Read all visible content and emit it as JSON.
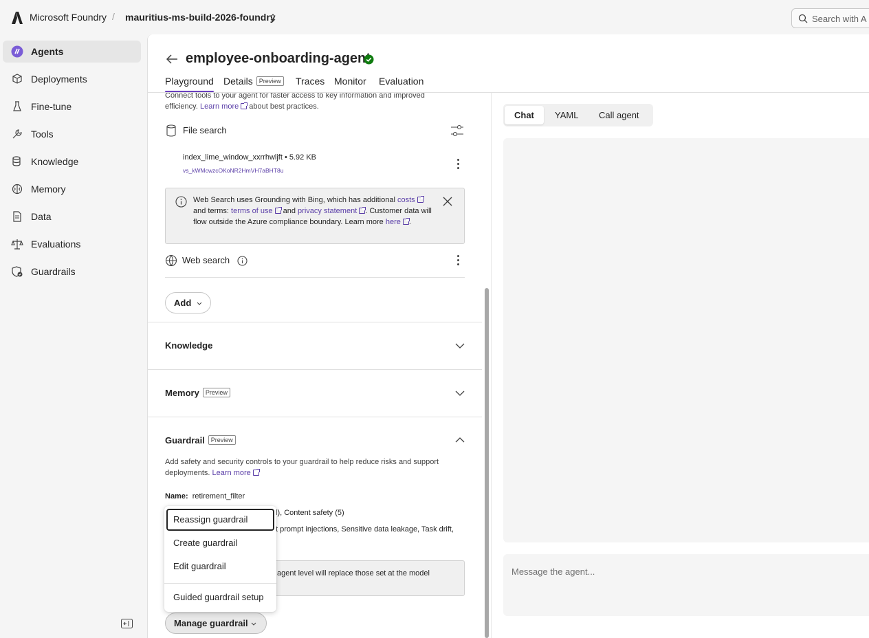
{
  "topbar": {
    "brand": "Microsoft Foundry",
    "separator": "/",
    "project": "mauritius-ms-build-2026-foundry",
    "search_placeholder": "Search with A"
  },
  "sidebar": {
    "items": [
      {
        "label": "Agents",
        "icon": "agents-icon",
        "active": true
      },
      {
        "label": "Deployments",
        "icon": "deployments-icon"
      },
      {
        "label": "Fine-tune",
        "icon": "flask-icon"
      },
      {
        "label": "Tools",
        "icon": "wrench-icon"
      },
      {
        "label": "Knowledge",
        "icon": "database-icon"
      },
      {
        "label": "Memory",
        "icon": "brain-icon"
      },
      {
        "label": "Data",
        "icon": "document-icon"
      },
      {
        "label": "Evaluations",
        "icon": "scale-icon"
      },
      {
        "label": "Guardrails",
        "icon": "shield-icon"
      }
    ]
  },
  "agent": {
    "title": "employee-onboarding-agent",
    "status_color": "#107c10"
  },
  "tabs": [
    {
      "label": "Playground",
      "active": true
    },
    {
      "label": "Details",
      "badge": "Preview"
    },
    {
      "label": "Traces"
    },
    {
      "label": "Monitor"
    },
    {
      "label": "Evaluation"
    }
  ],
  "tools": {
    "intro_text": "Connect tools to your agent for faster access to key information and improved efficiency.",
    "intro_link": "Learn more",
    "intro_suffix": "about best practices.",
    "file_search": {
      "title": "File search",
      "file_name": "index_lime_window_xxrrhwljft • 5.92 KB",
      "file_id": "vs_kWMcwzcOKoNR2HmVH7aBHT8u"
    },
    "notice": {
      "t1": "Web Search uses Grounding with Bing, which has additional",
      "l1": "costs",
      "t2": "and terms:",
      "l2": "terms of use",
      "t3": "and",
      "l3": "privacy statement",
      "t4": ". Customer data will flow outside the Azure compliance boundary. Learn more",
      "l4": "here",
      "t5": "."
    },
    "web_search": {
      "title": "Web search"
    },
    "add_label": "Add"
  },
  "sections": {
    "knowledge": "Knowledge",
    "memory": "Memory",
    "memory_badge": "Preview",
    "guardrail": "Guardrail",
    "guardrail_badge": "Preview"
  },
  "guardrail": {
    "description": "Add safety and security controls to your guardrail to help reduce risks and support deployments.",
    "learn_more": "Learn more",
    "name_label": "Name:",
    "name_value": "retirement_filter",
    "line2": "l), Content safety (5)",
    "line3": "t prompt injections, Sensitive data leakage, Task drift,",
    "warning": "agent level will replace those set at the model",
    "manage_label": "Manage guardrail"
  },
  "menu": {
    "items": [
      "Reassign guardrail",
      "Create guardrail",
      "Edit guardrail",
      "Guided guardrail setup"
    ]
  },
  "chat": {
    "modes": [
      "Chat",
      "YAML",
      "Call agent"
    ],
    "placeholder": "Message the agent..."
  },
  "colors": {
    "accent": "#6a3fbf",
    "link": "#5b3fa8"
  }
}
